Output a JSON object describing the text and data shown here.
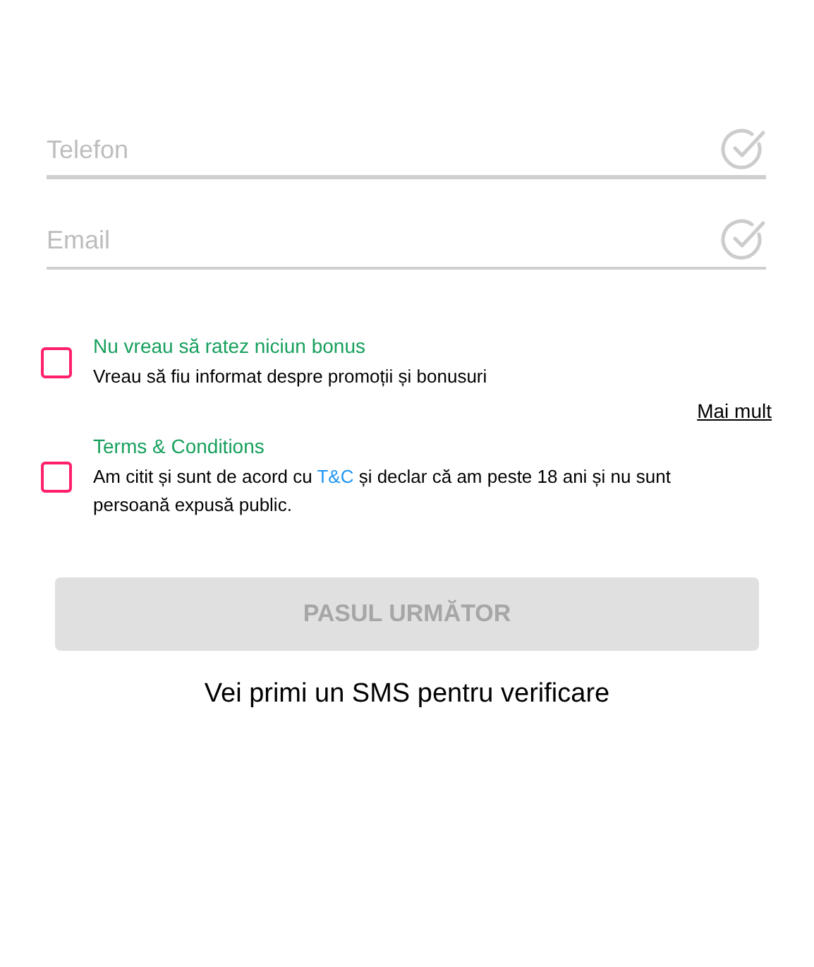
{
  "fields": [
    {
      "placeholder": "Telefon",
      "focused": true
    },
    {
      "placeholder": "Email",
      "focused": false
    }
  ],
  "consents": [
    {
      "title": "Nu vreau să ratez niciun bonus",
      "text_before": "Vreau să fiu informat despre promoții și bonusuri",
      "checked": false,
      "more_link": "Mai mult"
    },
    {
      "title": "Terms & Conditions",
      "text_before": "Am citit și sunt de acord cu ",
      "link": "T&C",
      "text_after": " și declar că am peste 18 ani și nu sunt persoană expusă public.",
      "checked": false
    }
  ],
  "next_button": {
    "label": "PASUL URMĂTOR",
    "disabled": true
  },
  "sms_note": "Vei primi un SMS pentru verificare"
}
